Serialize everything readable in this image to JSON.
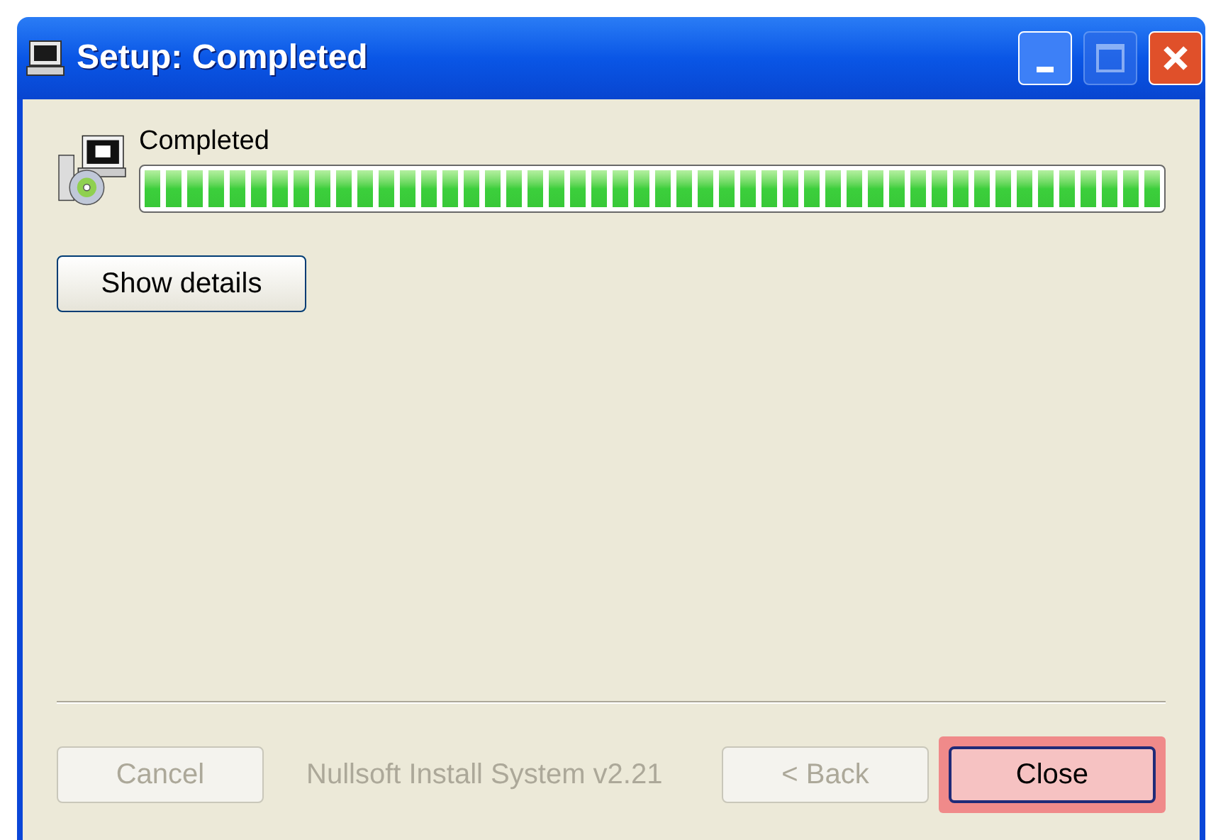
{
  "window": {
    "title": "Setup: Completed",
    "maximize_disabled": true
  },
  "status": {
    "label": "Completed",
    "level": 1
  },
  "details_button": {
    "label": "Show details",
    "disabled": false
  },
  "footer": {
    "cancel": {
      "label": "Cancel",
      "disabled": true
    },
    "branding": "Nullsoft Install System v2.21",
    "nav_buttons": [
      {
        "label": "< Back",
        "disabled": true,
        "highlighted": false
      },
      {
        "label": "Close",
        "disabled": false,
        "highlighted": true
      }
    ]
  }
}
